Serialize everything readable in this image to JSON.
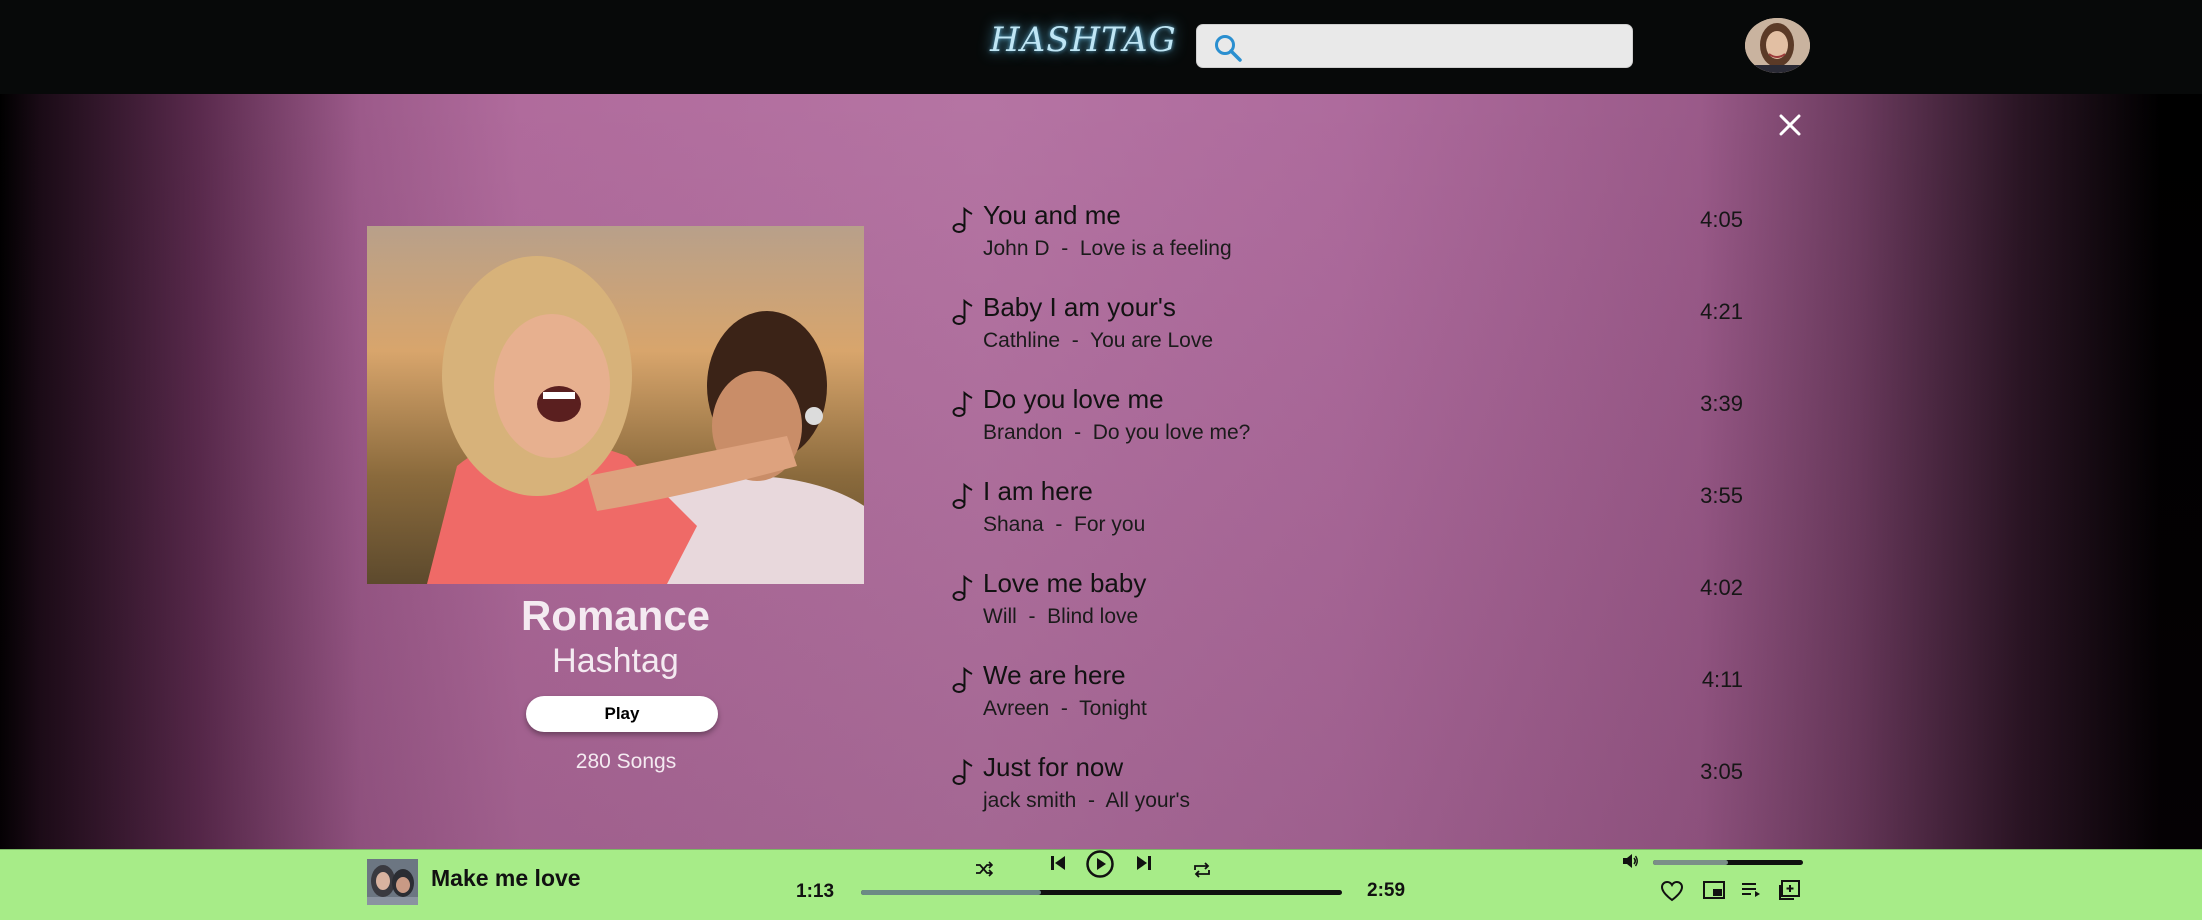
{
  "header": {
    "logo_text": "HASHTAG",
    "search_placeholder": "",
    "search_icon": "search-icon",
    "avatar_icon": "user-avatar"
  },
  "colors": {
    "topbar_bg": "#070909",
    "accent_logo": "#bfe6f5",
    "search_icon": "#2a8fd0",
    "main_purple": "#b06b9c",
    "player_bg": "#a7ec88"
  },
  "album": {
    "title": "Romance",
    "subtitle": "Hashtag",
    "play_label": "Play",
    "song_count": "280 Songs"
  },
  "tracks": [
    {
      "title": "You and me",
      "subtitle": "John D  -  Love is a feeling",
      "duration": "4:05"
    },
    {
      "title": "Baby I am your's",
      "subtitle": "Cathline  -  You are Love",
      "duration": "4:21"
    },
    {
      "title": "Do you love me",
      "subtitle": "Brandon  -  Do you love me?",
      "duration": "3:39"
    },
    {
      "title": "I am here",
      "subtitle": "Shana  -  For you",
      "duration": "3:55"
    },
    {
      "title": "Love me baby",
      "subtitle": "Will  -  Blind love",
      "duration": "4:02"
    },
    {
      "title": "We are here",
      "subtitle": "Avreen  -  Tonight",
      "duration": "4:11"
    },
    {
      "title": "Just for now",
      "subtitle": "jack smith  -  All your's",
      "duration": "3:05"
    }
  ],
  "player": {
    "now_playing_title": "Make me love",
    "current_time": "1:13",
    "total_time": "2:59",
    "progress_fraction": 0.375,
    "volume_fraction": 0.5
  }
}
